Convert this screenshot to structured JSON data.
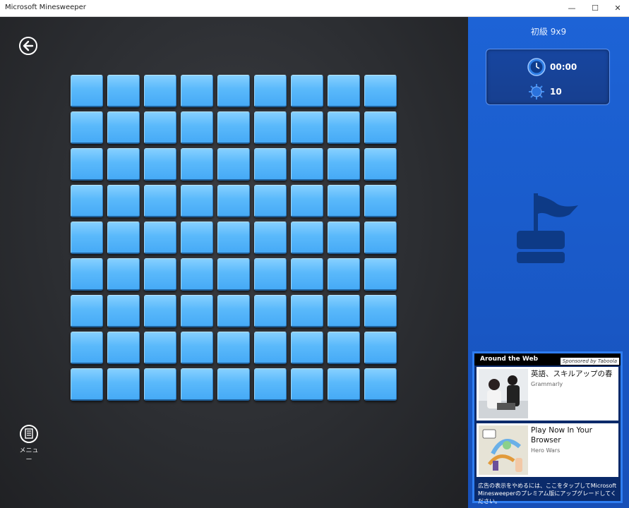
{
  "window": {
    "title": "Microsoft Minesweeper",
    "minimize": "—",
    "maximize": "☐",
    "close": "✕"
  },
  "game": {
    "rows": 9,
    "cols": 9,
    "menu_label": "メニュー"
  },
  "panel": {
    "level": "初級 9x9",
    "time": "00:00",
    "mines": "10"
  },
  "ad": {
    "header": "Around the Web",
    "sponsor": "Sponsored by Taboola",
    "items": [
      {
        "headline": "英語、スキルアップの春",
        "source": "Grammarly"
      },
      {
        "headline": "Play Now In Your Browser",
        "source": "Hero Wars"
      }
    ],
    "footer": "広告の表示をやめるには、ここをタップしてMicrosoft Minesweeperのプレミアム版にアップグレードしてください。"
  },
  "colors": {
    "tile": "#5ab9fb",
    "panel": "#1a5ccc"
  }
}
